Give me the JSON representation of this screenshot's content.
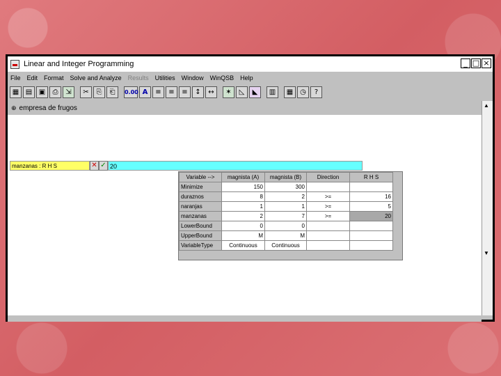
{
  "window": {
    "title": "Linear and Integer Programming"
  },
  "menu": [
    "File",
    "Edit",
    "Format",
    "Solve and Analyze",
    "Results",
    "Utilities",
    "Window",
    "WinQSB",
    "Help"
  ],
  "menu_disabled": [
    "Results"
  ],
  "document": {
    "title": "empresa de frugos"
  },
  "editbar": {
    "cell_name": "manzanas : R H S",
    "value": "20"
  },
  "table": {
    "headers": [
      "Variable -->",
      "magnista (A)",
      "magnista (B)",
      "Direction",
      "R H S"
    ],
    "rows": [
      [
        "Minimize",
        "150",
        "300",
        "",
        ""
      ],
      [
        "duraznos",
        "8",
        "2",
        ">=",
        "16"
      ],
      [
        "naranjas",
        "1",
        "1",
        ">=",
        "5"
      ],
      [
        "manzanas",
        "2",
        "7",
        ">=",
        "20"
      ],
      [
        "LowerBound",
        "0",
        "0",
        "",
        ""
      ],
      [
        "UpperBound",
        "M",
        "M",
        "",
        ""
      ],
      [
        "VariableType",
        "Continuous",
        "Continuous",
        "",
        ""
      ]
    ]
  }
}
